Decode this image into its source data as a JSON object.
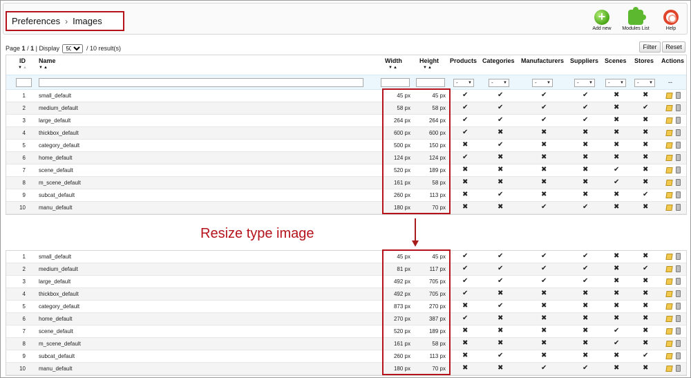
{
  "breadcrumb": {
    "parent": "Preferences",
    "separator": "›",
    "current": "Images"
  },
  "toolbar": {
    "add_new": "Add new",
    "modules_list": "Modules List",
    "help": "Help"
  },
  "pager": {
    "page_label": "Page",
    "page": "1",
    "pages": "1",
    "display_label": "Display",
    "display_value": "50",
    "results": "/ 10 result(s)"
  },
  "buttons": {
    "filter": "Filter",
    "reset": "Reset"
  },
  "columns": {
    "id": "ID",
    "name": "Name",
    "width": "Width",
    "height": "Height",
    "products": "Products",
    "categories": "Categories",
    "manufacturers": "Manufacturers",
    "suppliers": "Suppliers",
    "scenes": "Scenes",
    "stores": "Stores",
    "actions": "Actions"
  },
  "filter": {
    "select_value": "-",
    "actions_placeholder": "--"
  },
  "annotation": "Resize type image",
  "colors": {
    "highlight": "#b5121b",
    "check": "#4e9f1c",
    "cross": "#d9352b"
  },
  "table_before": [
    {
      "id": "1",
      "name": "small_default",
      "width": "45 px",
      "height": "45 px",
      "products": true,
      "categories": true,
      "manufacturers": true,
      "suppliers": true,
      "scenes": false,
      "stores": false
    },
    {
      "id": "2",
      "name": "medium_default",
      "width": "58 px",
      "height": "58 px",
      "products": true,
      "categories": true,
      "manufacturers": true,
      "suppliers": true,
      "scenes": false,
      "stores": true
    },
    {
      "id": "3",
      "name": "large_default",
      "width": "264 px",
      "height": "264 px",
      "products": true,
      "categories": true,
      "manufacturers": true,
      "suppliers": true,
      "scenes": false,
      "stores": false
    },
    {
      "id": "4",
      "name": "thickbox_default",
      "width": "600 px",
      "height": "600 px",
      "products": true,
      "categories": false,
      "manufacturers": false,
      "suppliers": false,
      "scenes": false,
      "stores": false
    },
    {
      "id": "5",
      "name": "category_default",
      "width": "500 px",
      "height": "150 px",
      "products": false,
      "categories": true,
      "manufacturers": false,
      "suppliers": false,
      "scenes": false,
      "stores": false
    },
    {
      "id": "6",
      "name": "home_default",
      "width": "124 px",
      "height": "124 px",
      "products": true,
      "categories": false,
      "manufacturers": false,
      "suppliers": false,
      "scenes": false,
      "stores": false
    },
    {
      "id": "7",
      "name": "scene_default",
      "width": "520 px",
      "height": "189 px",
      "products": false,
      "categories": false,
      "manufacturers": false,
      "suppliers": false,
      "scenes": true,
      "stores": false
    },
    {
      "id": "8",
      "name": "m_scene_default",
      "width": "161 px",
      "height": "58 px",
      "products": false,
      "categories": false,
      "manufacturers": false,
      "suppliers": false,
      "scenes": true,
      "stores": false
    },
    {
      "id": "9",
      "name": "subcat_default",
      "width": "260 px",
      "height": "113 px",
      "products": false,
      "categories": true,
      "manufacturers": false,
      "suppliers": false,
      "scenes": false,
      "stores": true
    },
    {
      "id": "10",
      "name": "manu_default",
      "width": "180 px",
      "height": "70 px",
      "products": false,
      "categories": false,
      "manufacturers": true,
      "suppliers": true,
      "scenes": false,
      "stores": false
    }
  ],
  "table_after": [
    {
      "id": "1",
      "name": "small_default",
      "width": "45 px",
      "height": "45 px",
      "products": true,
      "categories": true,
      "manufacturers": true,
      "suppliers": true,
      "scenes": false,
      "stores": false
    },
    {
      "id": "2",
      "name": "medium_default",
      "width": "81 px",
      "height": "117 px",
      "products": true,
      "categories": true,
      "manufacturers": true,
      "suppliers": true,
      "scenes": false,
      "stores": true
    },
    {
      "id": "3",
      "name": "large_default",
      "width": "492 px",
      "height": "705 px",
      "products": true,
      "categories": true,
      "manufacturers": true,
      "suppliers": true,
      "scenes": false,
      "stores": false
    },
    {
      "id": "4",
      "name": "thickbox_default",
      "width": "492 px",
      "height": "705 px",
      "products": true,
      "categories": false,
      "manufacturers": false,
      "suppliers": false,
      "scenes": false,
      "stores": false
    },
    {
      "id": "5",
      "name": "category_default",
      "width": "873 px",
      "height": "270 px",
      "products": false,
      "categories": true,
      "manufacturers": false,
      "suppliers": false,
      "scenes": false,
      "stores": false
    },
    {
      "id": "6",
      "name": "home_default",
      "width": "270 px",
      "height": "387 px",
      "products": true,
      "categories": false,
      "manufacturers": false,
      "suppliers": false,
      "scenes": false,
      "stores": false
    },
    {
      "id": "7",
      "name": "scene_default",
      "width": "520 px",
      "height": "189 px",
      "products": false,
      "categories": false,
      "manufacturers": false,
      "suppliers": false,
      "scenes": true,
      "stores": false
    },
    {
      "id": "8",
      "name": "m_scene_default",
      "width": "161 px",
      "height": "58 px",
      "products": false,
      "categories": false,
      "manufacturers": false,
      "suppliers": false,
      "scenes": true,
      "stores": false
    },
    {
      "id": "9",
      "name": "subcat_default",
      "width": "260 px",
      "height": "113 px",
      "products": false,
      "categories": true,
      "manufacturers": false,
      "suppliers": false,
      "scenes": false,
      "stores": true
    },
    {
      "id": "10",
      "name": "manu_default",
      "width": "180 px",
      "height": "70 px",
      "products": false,
      "categories": false,
      "manufacturers": true,
      "suppliers": true,
      "scenes": false,
      "stores": false
    }
  ]
}
